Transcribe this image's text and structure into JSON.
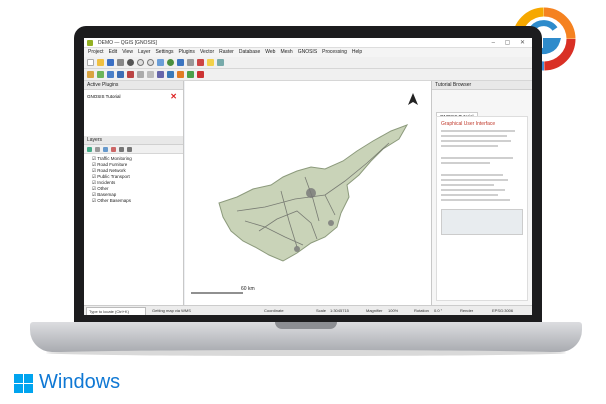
{
  "window": {
    "title": "DEMO — QGIS [GNOSIS]"
  },
  "menu": [
    "Project",
    "Edit",
    "View",
    "Layer",
    "Settings",
    "Plugins",
    "Vector",
    "Raster",
    "Database",
    "Web",
    "Mesh",
    "GNOSIS",
    "Processing",
    "Help"
  ],
  "panels": {
    "active_plugins": {
      "title": "Active Plugins",
      "items": [
        {
          "label": "GNOSIS Tutorial"
        }
      ]
    },
    "layers": {
      "title": "Layers",
      "items": [
        "Traffic Monitoring",
        "Road Furniture",
        "Road Network",
        "Public Transport",
        "Incidents",
        "Other",
        "Basemap",
        "Other Basemaps"
      ]
    },
    "tutorial_browser": {
      "title": "Tutorial Browser",
      "tab": "GNOSIS Tutorial",
      "heading": "Graphical User Interface"
    }
  },
  "map": {
    "scale_label": "60 km"
  },
  "status": {
    "search_placeholder": "Type to locate (Ctrl+K)",
    "message": "Getting map via WMS",
    "coordinate_label": "Coordinate",
    "scale_label": "Scale",
    "scale_value": "1:3045715",
    "magnifier_label": "Magnifier",
    "magnifier_value": "100%",
    "rotation_label": "Rotation",
    "rotation_value": "0.0 °",
    "render_label": "Render",
    "crs": "EPSG:3006"
  },
  "branding": {
    "os_name": "Windows"
  },
  "colors": {
    "os_blue": "#0f78d4",
    "tile_blue": "#00a4ef",
    "qgis_green": "#93b023"
  }
}
